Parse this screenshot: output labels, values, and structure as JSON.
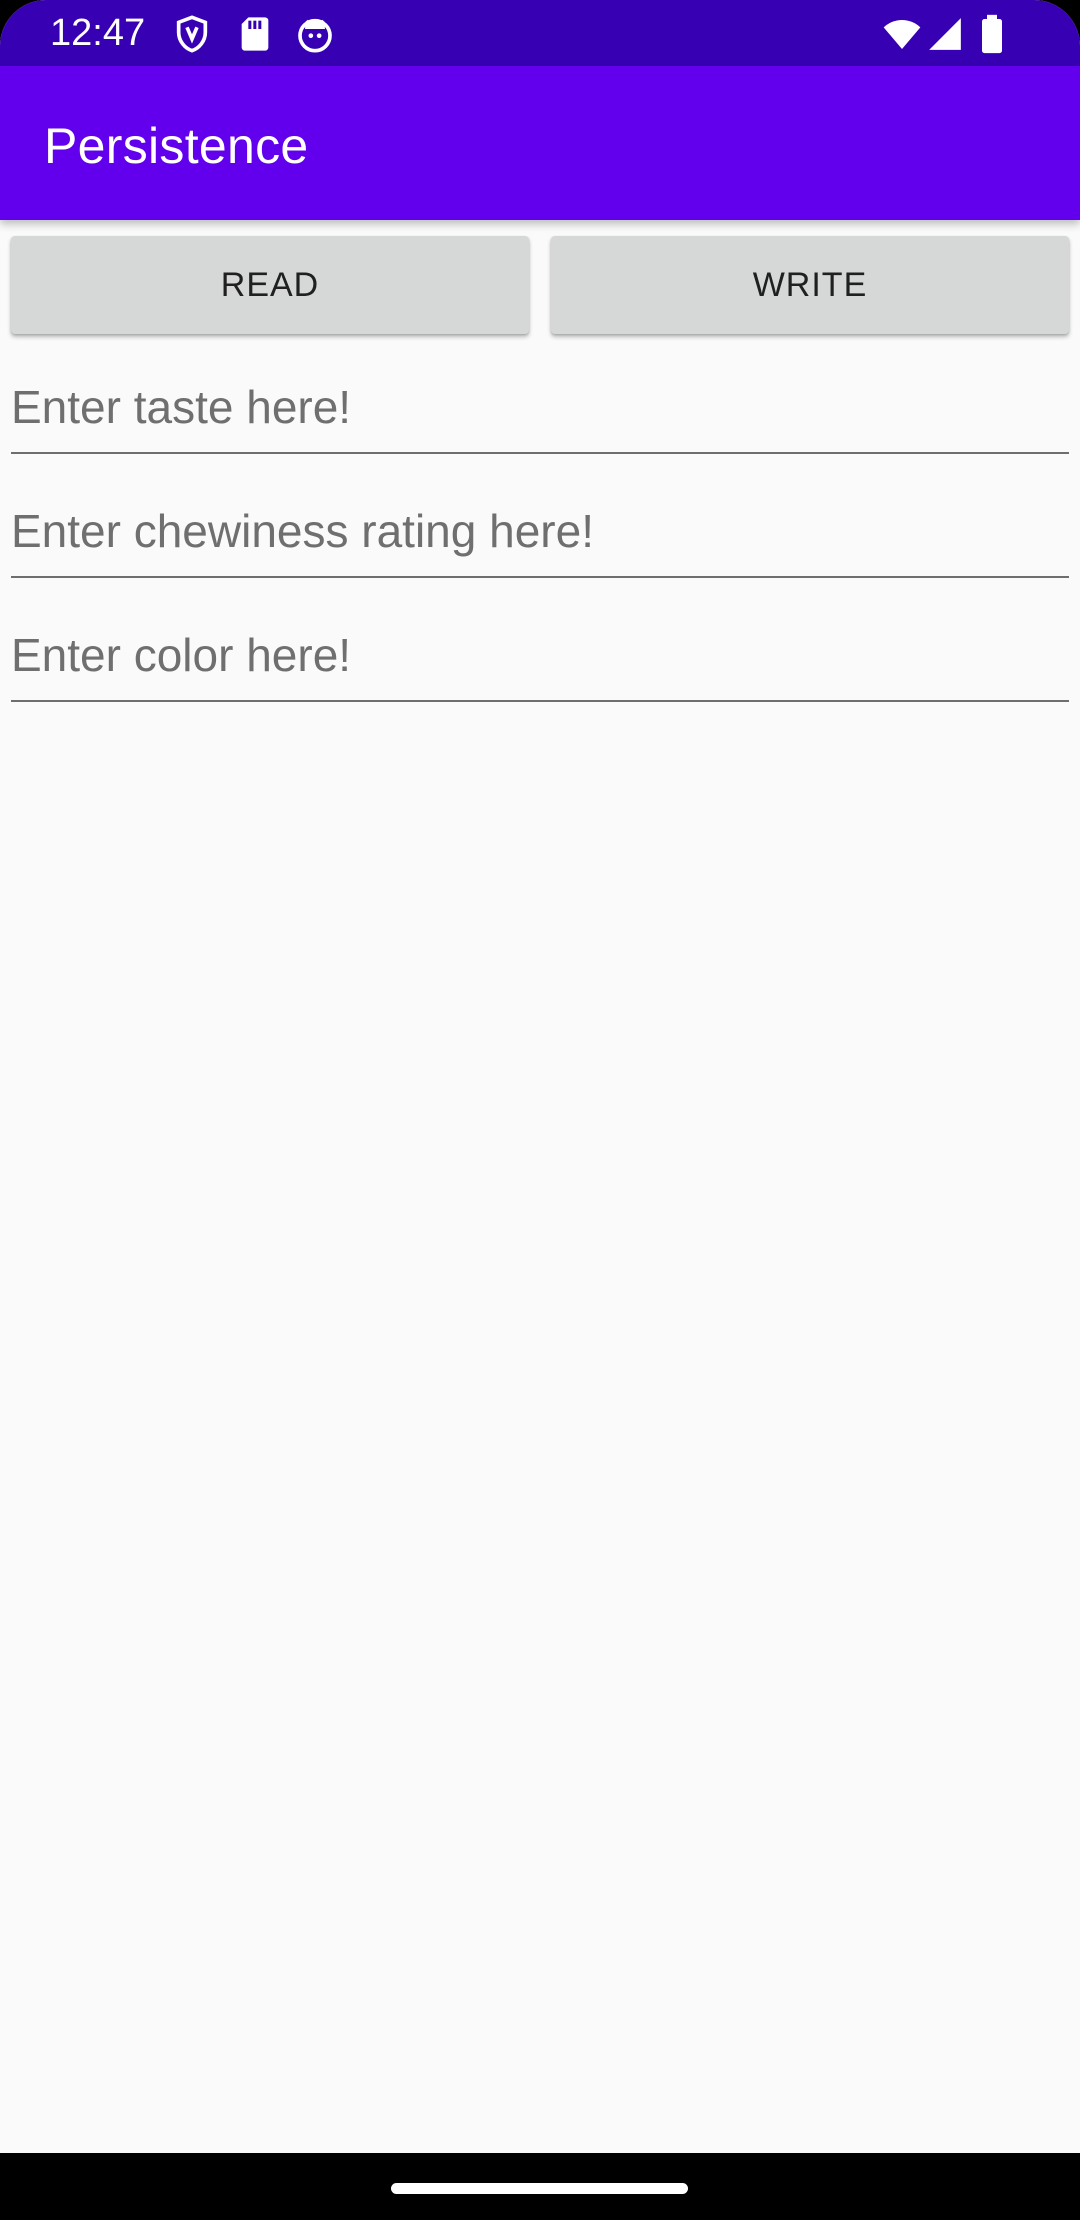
{
  "status_bar": {
    "time": "12:47",
    "left_icons": [
      "shield-icon",
      "sd-card-icon",
      "android-debug-icon"
    ],
    "right_icons": [
      "wifi-icon",
      "cell-signal-icon",
      "battery-icon"
    ],
    "background_color": "#3700b3"
  },
  "app_bar": {
    "title": "Persistence",
    "background_color": "#6200ee"
  },
  "buttons": {
    "read_label": "READ",
    "write_label": "WRITE"
  },
  "fields": {
    "taste": {
      "value": "",
      "placeholder": "Enter taste here!"
    },
    "chewiness": {
      "value": "",
      "placeholder": "Enter chewiness rating here!"
    },
    "color": {
      "value": "",
      "placeholder": "Enter color here!"
    }
  }
}
